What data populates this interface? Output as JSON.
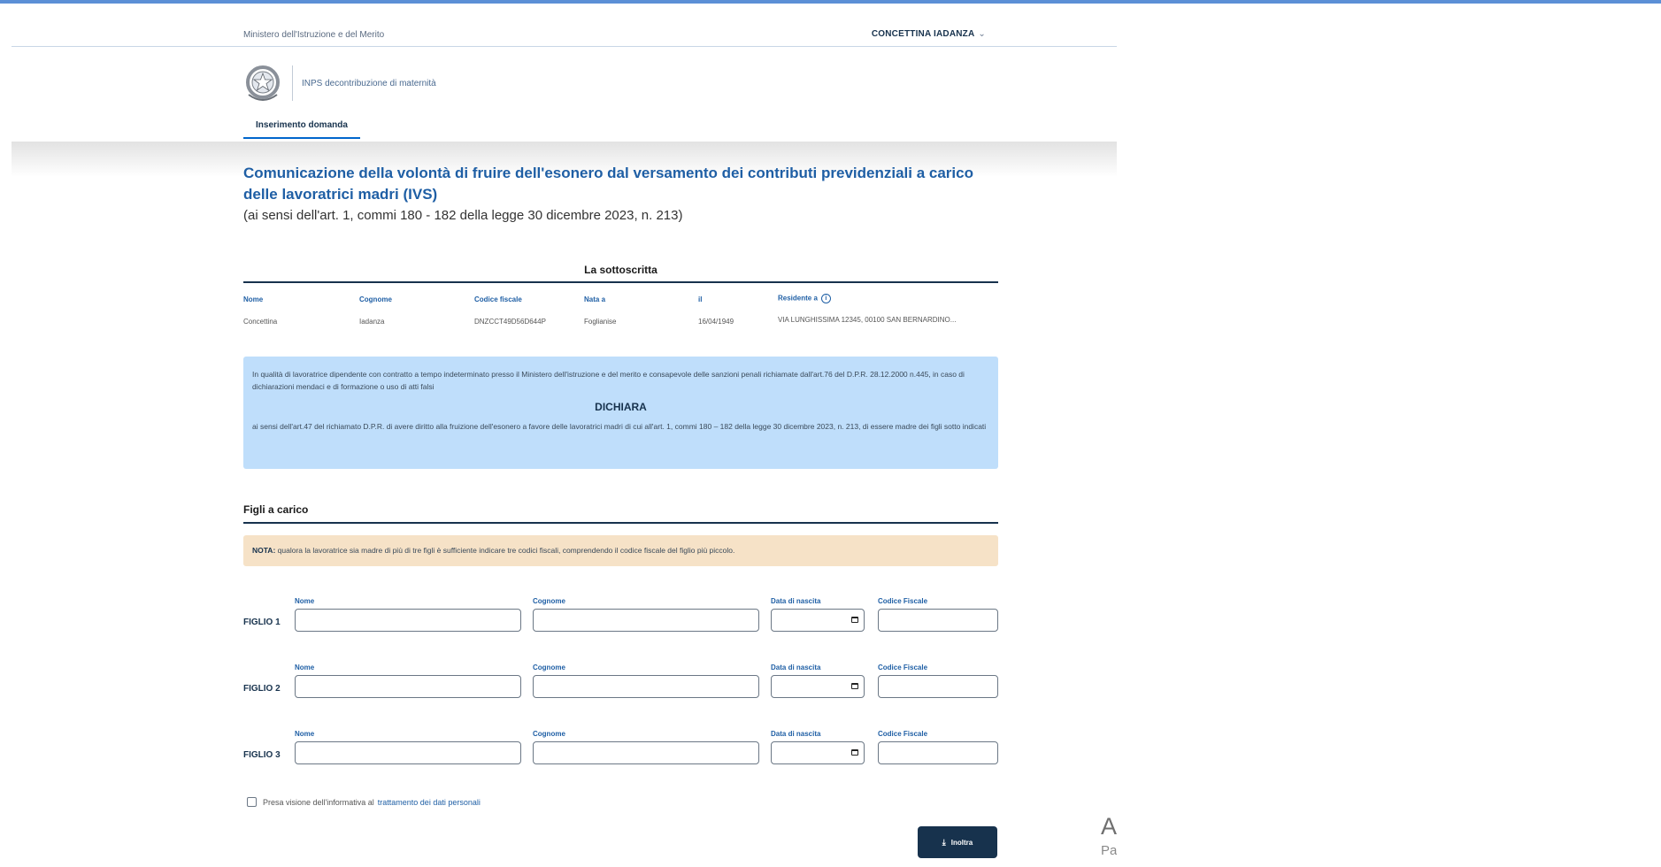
{
  "header": {
    "ministry": "Ministero dell'Istruzione e del Merito",
    "user_name": "CONCETTINA IADANZA",
    "service_name": "INPS decontribuzione di maternità",
    "nav_tab": "Inserimento domanda"
  },
  "page": {
    "title": "Comunicazione della volontà di fruire dell'esonero dal versamento dei contributi previdenziali a carico delle lavoratrici madri (IVS)",
    "subtitle": "(ai sensi dell'art. 1, commi 180 - 182 della legge 30 dicembre 2023, n. 213)"
  },
  "sottoscritta": {
    "heading": "La sottoscritta",
    "labels": {
      "nome": "Nome",
      "cognome": "Cognome",
      "codice_fiscale": "Codice fiscale",
      "nata_a": "Nata a",
      "il": "il",
      "residente_a": "Residente a"
    },
    "values": {
      "nome": "Concettina",
      "cognome": "Iadanza",
      "codice_fiscale": "DNZCCT49D56D644P",
      "nata_a": "Foglianise",
      "il": "16/04/1949",
      "residente_a": "VIA LUNGHISSIMA 12345, 00100 SAN BERNARDINO..."
    }
  },
  "declaration": {
    "intro": "In qualità di lavoratrice dipendente con contratto a tempo indeterminato presso il Ministero dell'istruzione e del merito e consapevole delle sanzioni penali richiamate dall'art.76 del D.P.R. 28.12.2000 n.445, in caso di dichiarazioni mendaci e di formazione o uso di atti falsi",
    "heading": "DICHIARA",
    "body": "ai sensi dell'art.47 del richiamato D.P.R. di avere diritto alla fruizione dell'esonero a favore delle lavoratrici madri di cui all'art. 1, commi 180 – 182 della legge 30 dicembre 2023, n. 213, di essere madre dei figli sotto indicati"
  },
  "figli": {
    "heading": "Figli a carico",
    "note_label": "NOTA:",
    "note_text": "qualora la lavoratrice sia madre di più di tre figli è sufficiente indicare tre codici fiscali, comprendendo il codice fiscale del figlio più piccolo.",
    "field_labels": {
      "nome": "Nome",
      "cognome": "Cognome",
      "data_nascita": "Data di nascita",
      "codice_fiscale": "Codice Fiscale"
    },
    "rows": [
      {
        "label": "FIGLIO 1",
        "nome": "",
        "cognome": "",
        "data_nascita": "",
        "codice_fiscale": ""
      },
      {
        "label": "FIGLIO 2",
        "nome": "",
        "cognome": "",
        "data_nascita": "",
        "codice_fiscale": ""
      },
      {
        "label": "FIGLIO 3",
        "nome": "",
        "cognome": "",
        "data_nascita": "",
        "codice_fiscale": ""
      }
    ]
  },
  "consent": {
    "text": "Presa visione dell'informativa al",
    "link": "trattamento dei dati personali",
    "checked": false
  },
  "submit": {
    "label": "Inoltra",
    "icon": "download-icon"
  },
  "overlay": {
    "line1": "At",
    "line2": "Pas"
  },
  "colors": {
    "primary": "#17324d",
    "title_blue": "#1f5fa5",
    "info_bg": "#bfdefb",
    "note_bg": "#f6e2c7",
    "top_rule": "#5b8fd6"
  }
}
